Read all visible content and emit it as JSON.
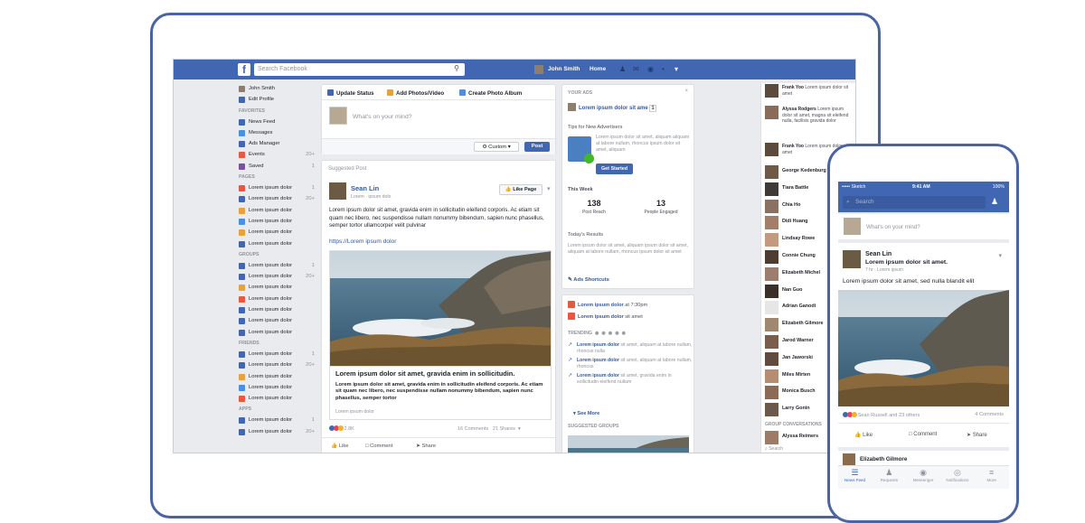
{
  "topbar": {
    "search_placeholder": "Search Facebook",
    "user_name": "John Smith",
    "home": "Home"
  },
  "left_nav": {
    "profile": [
      {
        "label": "John Smith",
        "color": "#8d7f6e"
      },
      {
        "label": "Edit Profile",
        "color": "#4267b2"
      }
    ],
    "favorites_header": "FAVORITES",
    "favorites": [
      {
        "label": "News Feed",
        "color": "#4267b2",
        "count": ""
      },
      {
        "label": "Messages",
        "color": "#4a90e2",
        "count": ""
      },
      {
        "label": "Ads Manager",
        "color": "#4267b2",
        "count": ""
      },
      {
        "label": "Events",
        "color": "#e9573f",
        "count": "20+"
      },
      {
        "label": "Saved",
        "color": "#7b4fa8",
        "count": "1"
      }
    ],
    "pages_header": "PAGES",
    "pages": [
      {
        "label": "Lorem ipsum dolor",
        "color": "#e9573f",
        "count": "1"
      },
      {
        "label": "Lorem ipsum dolor",
        "color": "#4267b2",
        "count": "20+"
      },
      {
        "label": "Lorem ipsum dolor",
        "color": "#e9a23b",
        "count": ""
      },
      {
        "label": "Lorem ipsum dolor",
        "color": "#4a90e2",
        "count": ""
      },
      {
        "label": "Lorem ipsum dolor",
        "color": "#e9a23b",
        "count": ""
      },
      {
        "label": "Lorem ipsum dolor",
        "color": "#4267b2",
        "count": ""
      }
    ],
    "groups_header": "GROUPS",
    "groups": [
      {
        "label": "Lorem ipsum dolor",
        "color": "#4267b2",
        "count": "1"
      },
      {
        "label": "Lorem ipsum dolor",
        "color": "#4267b2",
        "count": "20+"
      },
      {
        "label": "Lorem ipsum dolor",
        "color": "#e9a23b",
        "count": ""
      },
      {
        "label": "Lorem ipsum dolor",
        "color": "#e9573f",
        "count": ""
      },
      {
        "label": "Lorem ipsum dolor",
        "color": "#4267b2",
        "count": ""
      },
      {
        "label": "Lorem ipsum dolor",
        "color": "#4267b2",
        "count": ""
      },
      {
        "label": "Lorem ipsum dolor",
        "color": "#4267b2",
        "count": ""
      }
    ],
    "friends_header": "FRIENDS",
    "friends": [
      {
        "label": "Lorem ipsum dolor",
        "color": "#4267b2",
        "count": "1"
      },
      {
        "label": "Lorem ipsum dolor",
        "color": "#4267b2",
        "count": "20+"
      },
      {
        "label": "Lorem ipsum dolor",
        "color": "#e9a23b",
        "count": ""
      },
      {
        "label": "Lorem ipsum dolor",
        "color": "#4a90e2",
        "count": ""
      },
      {
        "label": "Lorem ipsum dolor",
        "color": "#e9573f",
        "count": ""
      }
    ],
    "apps_header": "APPS",
    "apps": [
      {
        "label": "Lorem ipsum dolor",
        "color": "#4267b2",
        "count": "1"
      },
      {
        "label": "Lorem ipsum dolor",
        "color": "#4267b2",
        "count": "20+"
      }
    ]
  },
  "composer": {
    "tab_status": "Update Status",
    "tab_photos": "Add Photos/Video",
    "tab_album": "Create Photo Album",
    "placeholder": "What's on your mind?",
    "privacy": "Custom",
    "post_button": "Post"
  },
  "post": {
    "suggested_label": "Suggested Post",
    "author": "Sean Lin",
    "author_sub": "Lorem · ipsum dolo",
    "like_page": "Like Page",
    "text": "Lorem ipsum dolor sit amet, gravida enim in sollicitudin eleifend corporis. Ac etiam sit quam nec libero, nec suspendisse nullam nonummy bibendum, sapien nunc phasellus, semper tortor ullamcorper velit pulvinar",
    "link": "https://Lorem ipsum dolor",
    "link_title": "Lorem ipsum dolor sit amet, gravida enim in sollicitudin.",
    "link_desc": "Lorem ipsum dolor sit amet, gravida enim in sollicitudin eleifend corporis. Ac etiam sit quam nec libero, nec suspendisse nullam nonummy bibendum, sapien nunc phasellus, semper tortor",
    "link_source": "Lorem ipsum dolor",
    "reactions": "2.8K",
    "comments": "16 Comments",
    "shares": "21 Shares",
    "like": "Like",
    "comment": "Comment",
    "share": "Share"
  },
  "ads": {
    "header": "YOUR ADS",
    "ad_name": "Lorem ipsum dolor sit ame",
    "ad_count": "1",
    "tips_title": "Tips for New Advertisers",
    "tips_text": "Lorem ipsum dolor sit amet, aliquam aliquam at labore nullam, rhoncus ipsum dolor sit amet, aliquam",
    "get_started": "Get Started",
    "this_week": "This Week",
    "stat1_value": "138",
    "stat1_label": "Post Reach",
    "stat2_value": "13",
    "stat2_label": "People Engaged",
    "todays_results": "Today's Results",
    "results_text": "Lorem ipsum dolor sit amet, aliquam ipsum dolor sit amet, aliquam at labore nullam, rhoncus ipsum dolor sit amet",
    "shortcuts": "Ads Shortcuts"
  },
  "trending": {
    "event1_name": "Lorem ipsum dolor",
    "event1_time": "at 7:30pm",
    "event2_name": "Lorem ipsum dolor",
    "event2_extra": "sit amet",
    "header": "TRENDING",
    "items": [
      {
        "bold": "Lorem ipsum dolor",
        "text": " sit amet, aliquam at labore nullam, rhoncus nulla"
      },
      {
        "bold": "Lorem ipsum dolor",
        "text": " sit amet, aliquam at labore nullam, rhoncus"
      },
      {
        "bold": "Lorem ipsum dolor",
        "text": " sit amet, gravida enim in sollicitudin eleifend nullam"
      }
    ],
    "see_more": "See More",
    "suggested_groups": "SUGGESTED GROUPS"
  },
  "chat": {
    "activity": [
      {
        "name": "Frank Yoo",
        "text": "Lorem ipsum dolor sit amet",
        "color": "#5c4a3c"
      },
      {
        "name": "Alyssa Rodgers",
        "text": "Lorem ipsum dolor sit amet, magna sit eleifend nulla, facilisis gravida dolor",
        "color": "#8a6b5a"
      },
      {
        "name": "Frank Yoo",
        "text": "Lorem ipsum dolor sit amet",
        "color": "#5c4a3c"
      }
    ],
    "contacts": [
      {
        "name": "George Kedenburg",
        "color": "#6f5a48"
      },
      {
        "name": "Tiara Battle",
        "color": "#3d3a38"
      },
      {
        "name": "Chia Ho",
        "color": "#8a7160"
      },
      {
        "name": "Didi Huang",
        "color": "#a47e66"
      },
      {
        "name": "Lindsay Rowe",
        "color": "#c49a7e"
      },
      {
        "name": "Connie Chung",
        "color": "#4f3c31"
      },
      {
        "name": "Elizabeth Michel",
        "color": "#9b7e6d"
      },
      {
        "name": "Nan Guo",
        "color": "#3b2f2a"
      },
      {
        "name": "Adrian Ganodi",
        "color": "#e6e6e6"
      },
      {
        "name": "Elizabeth Gilmore",
        "color": "#a08770"
      },
      {
        "name": "Jarod Warner",
        "color": "#7a5d4a"
      },
      {
        "name": "Jan Jaworski",
        "color": "#604b3e"
      },
      {
        "name": "Miles Mirten",
        "color": "#b58d72"
      },
      {
        "name": "Monica Busch",
        "color": "#8d6a55"
      },
      {
        "name": "Larry Gonin",
        "color": "#6b594b"
      }
    ],
    "group_conv": "GROUP CONVERSATIONS",
    "last": {
      "name": "Alyssa Reimers",
      "color": "#9d7b66"
    },
    "search": "Search"
  },
  "phone": {
    "carrier": "••••• Sketch",
    "time": "9:41 AM",
    "battery": "100%",
    "search": "Search",
    "composer": "What's on your mind?",
    "post_author": "Sean Lin",
    "post_title": "Lorem ipsum dolor sit amet.",
    "post_sub": "7 hr · Lorem ipsum",
    "post_text": "Lorem ipsum dolor sit amet, sed nulla blandit elit",
    "reactions": "Sean Russell and 23 others",
    "comments": "4 Comments",
    "like": "Like",
    "comment": "Comment",
    "share": "Share",
    "next_author": "Elizabeth Gilmore",
    "tabs": [
      "News Feed",
      "Requests",
      "Messenger",
      "Notifications",
      "More"
    ]
  }
}
